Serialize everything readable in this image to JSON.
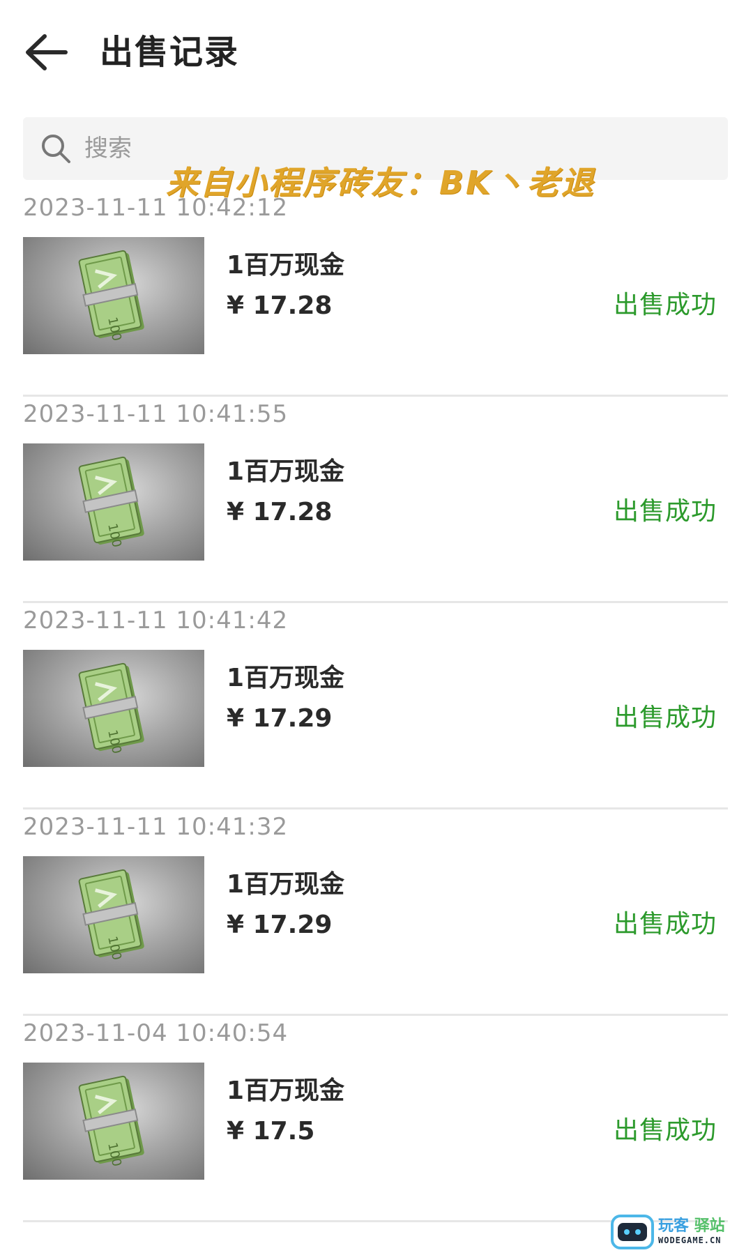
{
  "header": {
    "title": "出售记录"
  },
  "search": {
    "placeholder": "搜索"
  },
  "banner": {
    "text": "来自小程序砖友：BK丶老退"
  },
  "records": [
    {
      "time": "2023-11-11 10:42:12",
      "item": "1百万现金",
      "price": "¥ 17.28",
      "status": "出售成功"
    },
    {
      "time": "2023-11-11 10:41:55",
      "item": "1百万现金",
      "price": "¥ 17.28",
      "status": "出售成功"
    },
    {
      "time": "2023-11-11 10:41:42",
      "item": "1百万现金",
      "price": "¥ 17.29",
      "status": "出售成功"
    },
    {
      "time": "2023-11-11 10:41:32",
      "item": "1百万现金",
      "price": "¥ 17.29",
      "status": "出售成功"
    },
    {
      "time": "2023-11-04 10:40:54",
      "item": "1百万现金",
      "price": "¥ 17.5",
      "status": "出售成功"
    }
  ],
  "brand": {
    "name_part1": "玩客",
    "name_part2": "驿站",
    "domain": "WODEGAME.CN"
  },
  "colors": {
    "status_success": "#2c9a2c",
    "banner": "#e0a52a",
    "timestamp": "#9a9a9a"
  }
}
